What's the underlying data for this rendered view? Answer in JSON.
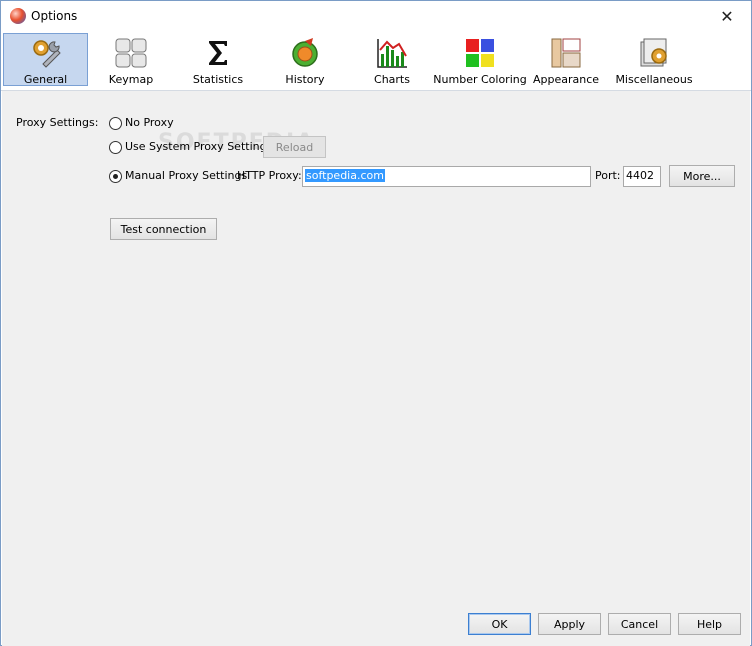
{
  "window": {
    "title": "Options",
    "close_glyph": "✕"
  },
  "toolbar": {
    "items": [
      {
        "label": "General",
        "icon": "general-icon",
        "active": true
      },
      {
        "label": "Keymap",
        "icon": "keymap-icon"
      },
      {
        "label": "Statistics",
        "icon": "sigma-icon"
      },
      {
        "label": "History",
        "icon": "history-icon"
      },
      {
        "label": "Charts",
        "icon": "charts-icon"
      },
      {
        "label": "Number Coloring",
        "icon": "number-coloring-icon"
      },
      {
        "label": "Appearance",
        "icon": "appearance-icon"
      },
      {
        "label": "Miscellaneous",
        "icon": "miscellaneous-icon"
      }
    ]
  },
  "proxy": {
    "section_label": "Proxy Settings:",
    "no_proxy": "No Proxy",
    "system_proxy": "Use System Proxy Settings",
    "reload": "Reload",
    "manual": "Manual Proxy Settings",
    "http_label": "HTTP Proxy:",
    "http_value": "softpedia.com",
    "port_label": "Port:",
    "port_value": "4402",
    "more": "More...",
    "selected": "manual"
  },
  "test_connection": "Test connection",
  "watermark": "SOFTPEDIA",
  "footer": {
    "ok": "OK",
    "apply": "Apply",
    "cancel": "Cancel",
    "help": "Help"
  },
  "colors": {
    "accent": "#3399ff",
    "active_tab": "#c6d7ef",
    "panel_bg": "#f0f0f0"
  }
}
